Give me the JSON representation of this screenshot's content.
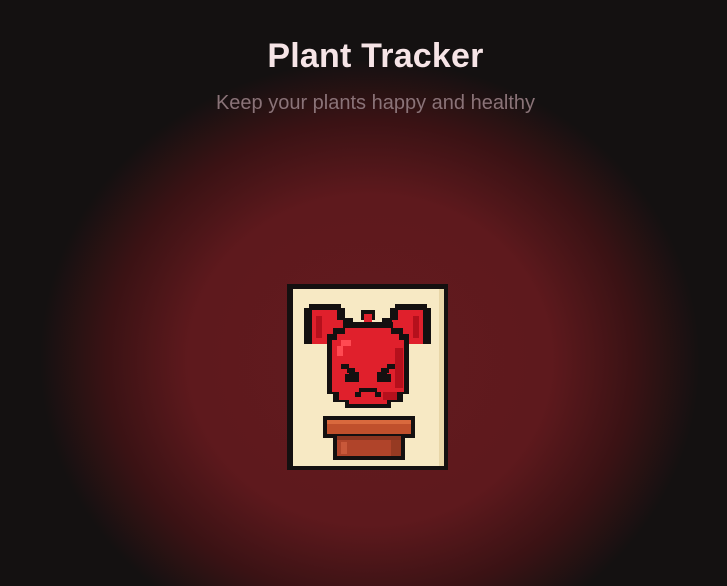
{
  "header": {
    "title": "Plant Tracker",
    "subtitle": "Keep your plants happy and healthy"
  },
  "plant": {
    "icon": "angry-red-plant-icon",
    "mood": "angry",
    "colors": {
      "card": "#f7e9c4",
      "outline": "#141010",
      "plant_red": "#e0202c",
      "pot": "#c0502c"
    }
  }
}
